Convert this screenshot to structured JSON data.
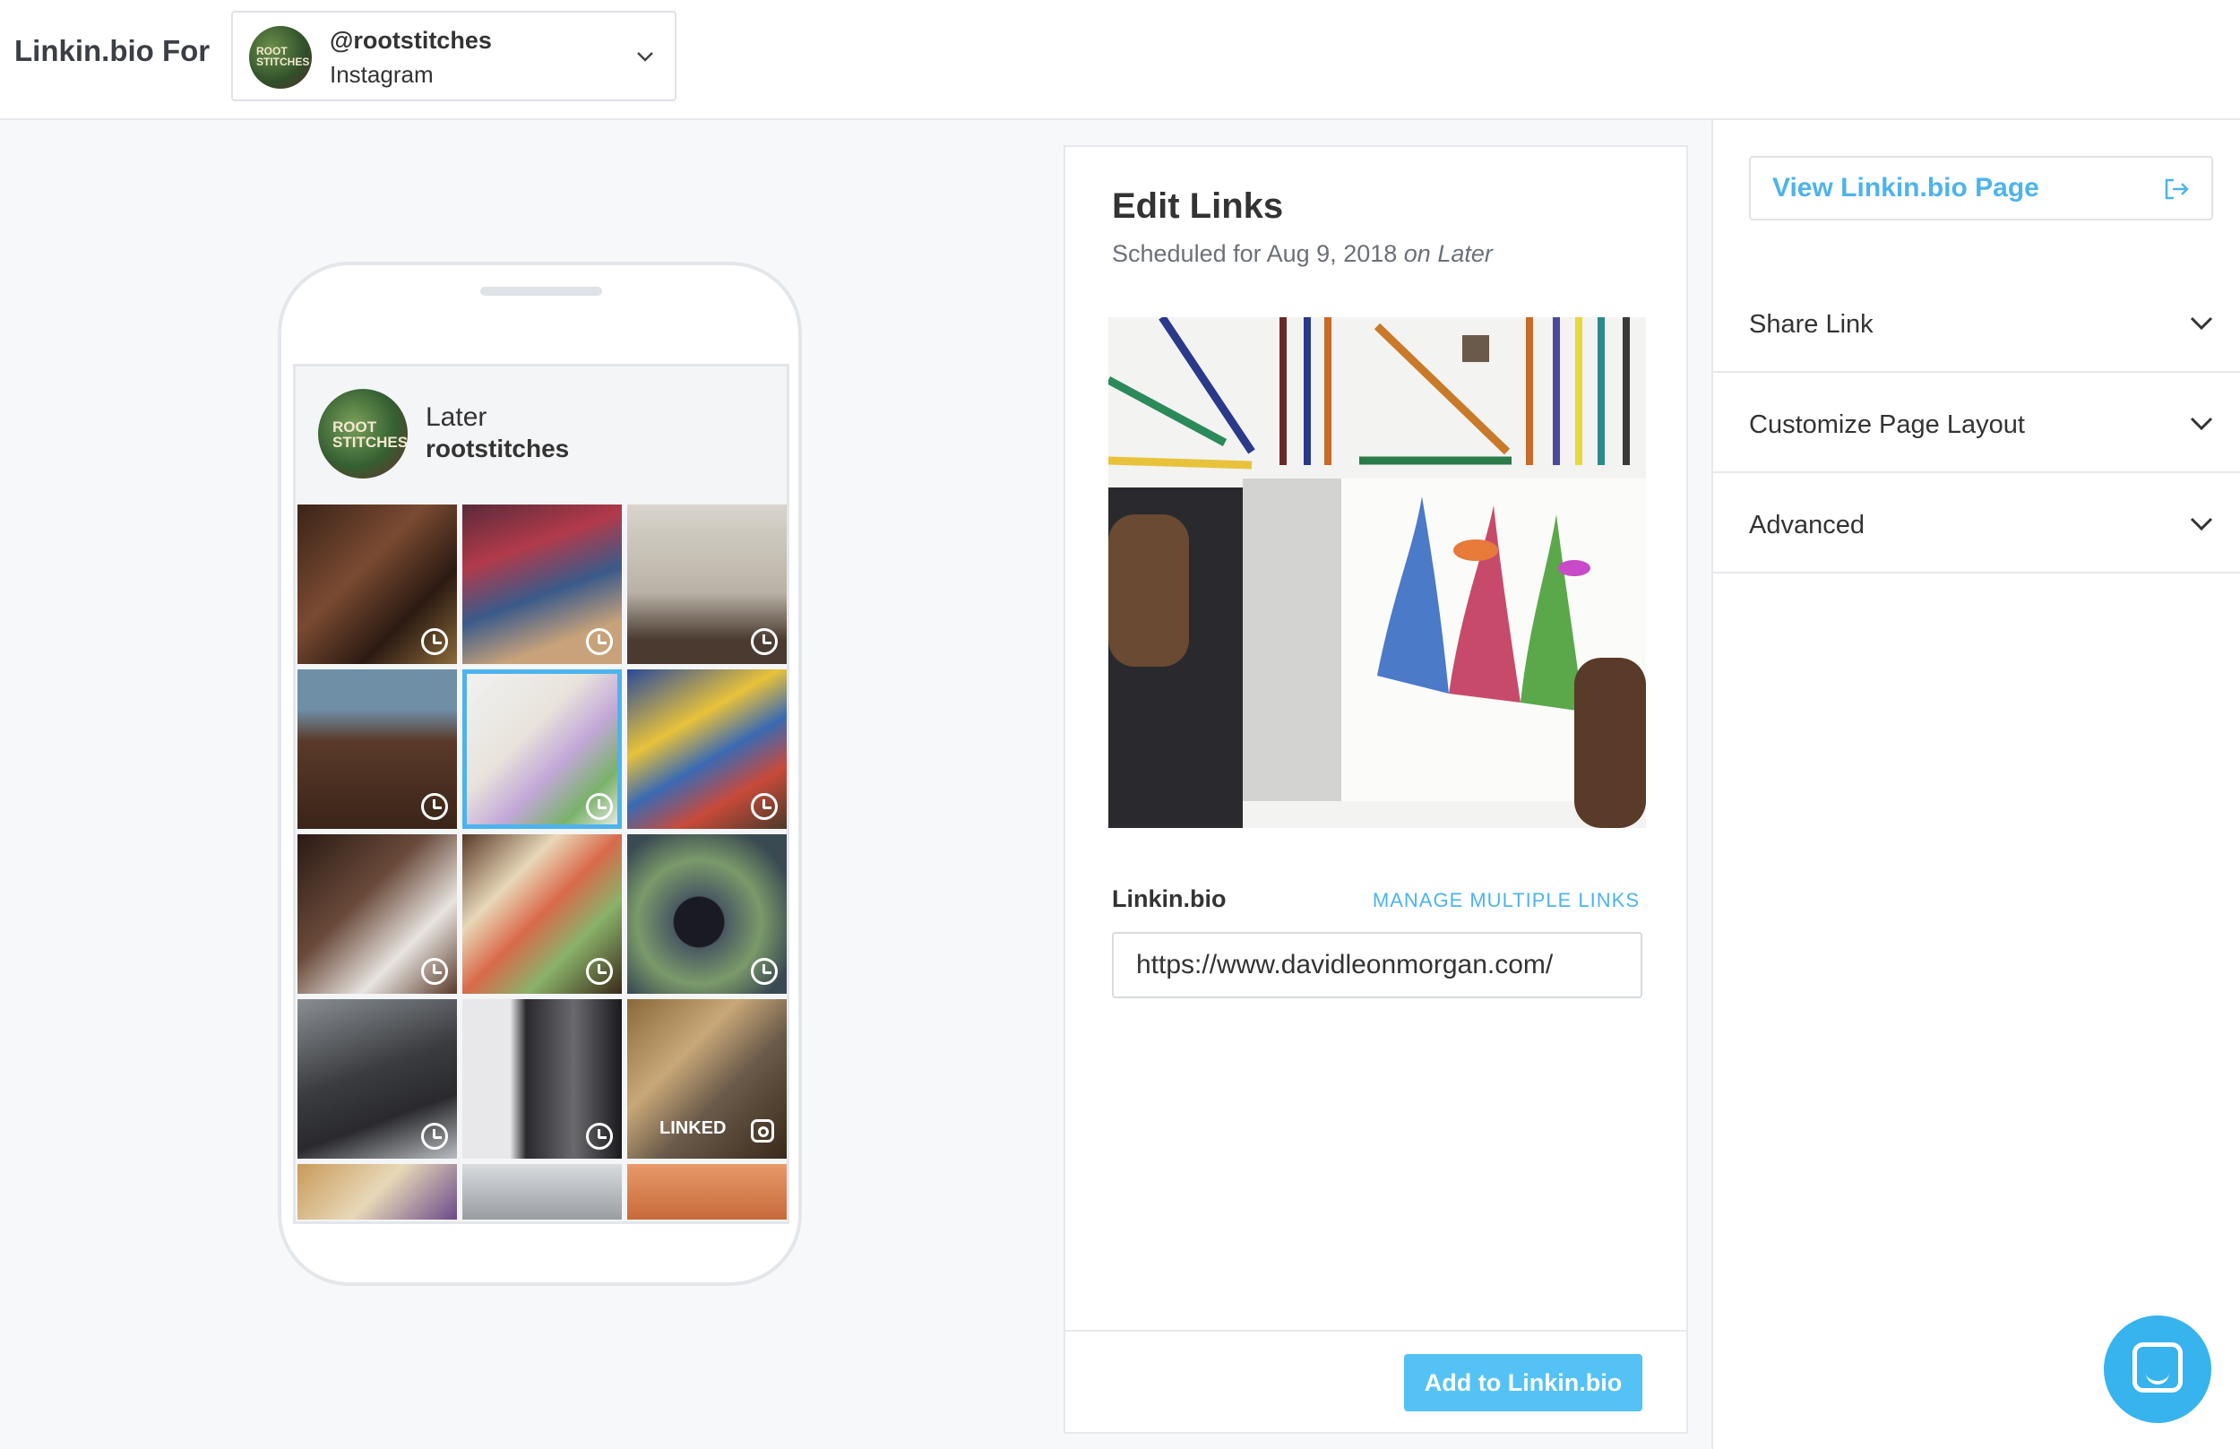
{
  "header": {
    "brand": "Linkin.bio For",
    "account": {
      "avatar_text": "ROOT STITCHES",
      "handle": "@rootstitches",
      "network": "Instagram"
    }
  },
  "phone_preview": {
    "profile": {
      "avatar_text": "ROOT STITCHES",
      "name": "Later",
      "handle": "rootstitches"
    },
    "tiles": [
      {
        "status": "scheduled"
      },
      {
        "status": "scheduled"
      },
      {
        "status": "scheduled"
      },
      {
        "status": "scheduled"
      },
      {
        "status": "scheduled",
        "selected": true
      },
      {
        "status": "scheduled"
      },
      {
        "status": "scheduled"
      },
      {
        "status": "scheduled"
      },
      {
        "status": "scheduled"
      },
      {
        "status": "scheduled"
      },
      {
        "status": "scheduled"
      },
      {
        "status": "linked",
        "label": "LINKED"
      },
      {
        "status": "partial"
      },
      {
        "status": "partial"
      },
      {
        "status": "partial"
      }
    ],
    "linked_label": "LINKED"
  },
  "edit_links": {
    "title": "Edit Links",
    "scheduled_prefix": "Scheduled for Aug 9, 2018",
    "scheduled_on": "on Later",
    "field_label": "Linkin.bio",
    "manage_link": "MANAGE MULTIPLE LINKS",
    "url_value": "https://www.davidleonmorgan.com/",
    "add_button": "Add to Linkin.bio"
  },
  "sidebar": {
    "view_button": "View Linkin.bio Page",
    "sections": [
      {
        "label": "Share Link"
      },
      {
        "label": "Customize Page Layout"
      },
      {
        "label": "Advanced"
      }
    ]
  },
  "colors": {
    "accent": "#4db3ee",
    "button": "#55c2f5",
    "chat": "#37b3ee"
  }
}
